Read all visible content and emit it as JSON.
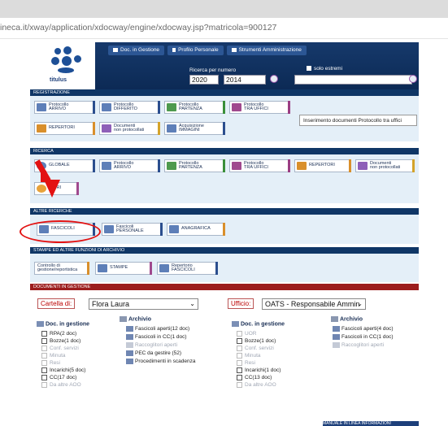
{
  "browser": {
    "url": "ineca.it/xway/application/xdocway/engine/xdocway.jsp?matricola=900127"
  },
  "header": {
    "logo_text": "titulus",
    "tabs": [
      "Doc. in Gestione",
      "Profilo Personale",
      "Strumenti Amministrazione"
    ],
    "ricerca_label": "Ricerca per numero",
    "year_from": "2020",
    "year_to": "2014",
    "solo_estremi": "solo estremi"
  },
  "sections": {
    "registrazione": "REGISTRAZIONE",
    "ricerca": "RICERCA",
    "altre_ricerche": "ALTRE RICERCHE",
    "stampe": "STAMPE ED ALTRE FUNZIONI DI ARCHIVIO",
    "documenti": "DOCUMENTI IN GESTIONE"
  },
  "registrazione": {
    "protocollo_arrivo": "Protocollo\nARRIVO",
    "protocollo_differito": "Protocollo\nDIFFERITO",
    "protocollo_partenza": "Protocollo\nPARTENZA",
    "protocollo_tra_uffici": "Protocollo\nTRA UFFICI",
    "repertori": "REPERTORI",
    "documenti_non_protocollati": "Documenti\nnon protocollati",
    "acquisizione_immagini": "Acquisizione\nIMMAGINI",
    "tooltip": "Inserimento documenti Protocollo tra uffici"
  },
  "ricerca": {
    "globale": "GLOBALE",
    "protocollo_arrivo": "Protocollo\nARRIVO",
    "protocollo_partenza": "Protocollo\nPARTENZA",
    "protocollo_tra_uffici": "Protocollo\nTRA UFFICI",
    "repertori": "REPERTORI",
    "documenti_non_protocollati": "Documenti\nnon protocollati",
    "altri": "ALTRI"
  },
  "altre_ricerche": {
    "fascicoli": "FASCICOLI",
    "fascicoli_personale": "Fascicoli\nPERSONALE",
    "anagrafica": "ANAGRAFICA"
  },
  "stampe": {
    "controllo": "Controllo di\ngestione/reportistica",
    "stampe": "STAMPE",
    "repertorio_fascicoli": "Repertorio\nFASCICOLI"
  },
  "documenti": {
    "cartella_label": "Cartella di:",
    "cartella_value": "Flora Laura",
    "ufficio_label": "Ufficio:",
    "ufficio_value": "OATS - Responsabile Ammin",
    "left": {
      "gestione_title": "Doc. in gestione",
      "gestione_items": [
        {
          "label": "RPA(2 doc)",
          "enabled": true
        },
        {
          "label": "Bozze(1 doc)",
          "enabled": true
        },
        {
          "label": "Conf. servizi",
          "enabled": false
        },
        {
          "label": "Minuta",
          "enabled": false
        },
        {
          "label": "Resi",
          "enabled": false
        },
        {
          "label": "Incarichi(5 doc)",
          "enabled": true
        },
        {
          "label": "CC(17 doc)",
          "enabled": true
        },
        {
          "label": "Da altre AOO",
          "enabled": false
        }
      ],
      "archivio_title": "Archivio",
      "archivio_items": [
        {
          "label": "Fascicoli aperti(12 doc)",
          "enabled": true
        },
        {
          "label": "Fascicoli in CC(1 doc)",
          "enabled": true
        },
        {
          "label": "Raccoglitori aperti",
          "enabled": false
        },
        {
          "label": "PEC da gestire (52)",
          "enabled": true
        },
        {
          "label": "Procedimenti in scadenza",
          "enabled": true
        }
      ]
    },
    "right": {
      "gestione_title": "Doc. in gestione",
      "gestione_items": [
        {
          "label": "UOR",
          "enabled": false
        },
        {
          "label": "Bozze(1 doc)",
          "enabled": true
        },
        {
          "label": "Conf. servizi",
          "enabled": false
        },
        {
          "label": "Minuta",
          "enabled": false
        },
        {
          "label": "Resi",
          "enabled": false
        },
        {
          "label": "Incarichi(1 doc)",
          "enabled": true
        },
        {
          "label": "CC(13 doc)",
          "enabled": true
        },
        {
          "label": "Da altre AOO",
          "enabled": false
        }
      ],
      "archivio_title": "Archivio",
      "archivio_items": [
        {
          "label": "Fascicoli aperti(4 doc)",
          "enabled": true
        },
        {
          "label": "Fascicoli in CC(1 doc)",
          "enabled": true
        },
        {
          "label": "Raccoglitori aperti",
          "enabled": false
        }
      ]
    }
  },
  "footer": {
    "text": "MANUALE IN LINEA    INFORMAZIONI"
  },
  "colors": {
    "navy": "#0f3666",
    "panel": "#e4eff8",
    "highlight_red": "#e31212",
    "docs_bar": "#9c1d1d"
  }
}
